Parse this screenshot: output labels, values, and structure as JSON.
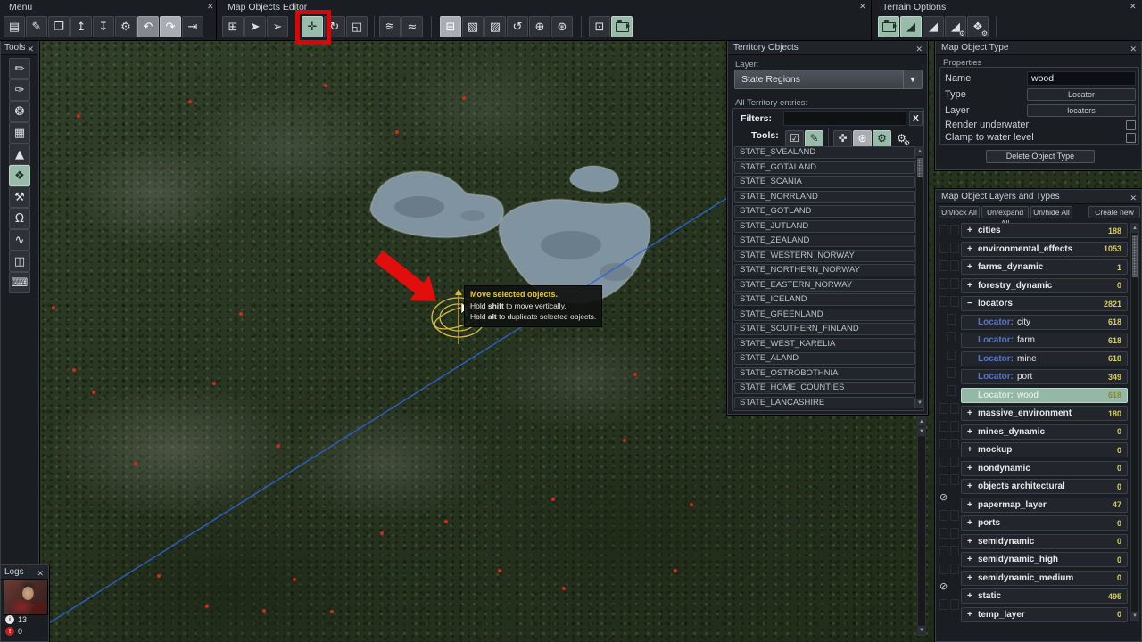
{
  "ui": {
    "close_glyph": "✕",
    "arrow_up": "▲",
    "arrow_down": "▼",
    "dropdown_arrow": "▼"
  },
  "colors": {
    "accent": "#98bca9",
    "count_yellow": "#d8ce62",
    "locator_blue": "#5377c7",
    "annotation_red": "#de0404",
    "gizmo_yellow": "#e3c23c"
  },
  "menu": {
    "title": "Menu",
    "tools": [
      {
        "icon": "save-icon",
        "glyph": "▤"
      },
      {
        "icon": "edit-icon",
        "glyph": "✎"
      },
      {
        "icon": "duplicate-icon",
        "glyph": "❐"
      },
      {
        "icon": "import-icon",
        "glyph": "↥"
      },
      {
        "icon": "export-icon",
        "glyph": "↧"
      },
      {
        "icon": "settings-gear-icon",
        "glyph": "⚙"
      },
      {
        "icon": "undo-icon",
        "glyph": "↶",
        "state": "pressed"
      },
      {
        "icon": "redo-icon",
        "glyph": "↷",
        "state": "pressed2"
      },
      {
        "icon": "exit-icon",
        "glyph": "⇥"
      }
    ]
  },
  "map_objects_editor": {
    "title": "Map Objects Editor",
    "groups": [
      [
        {
          "icon": "add-object-icon",
          "glyph": "⊞"
        },
        {
          "icon": "select-object-icon",
          "glyph": "➤"
        },
        {
          "icon": "box-select-object-icon",
          "glyph": "➢"
        }
      ],
      [
        {
          "icon": "move-object-icon",
          "glyph": "✛",
          "state": "selected",
          "boxed": true
        },
        {
          "icon": "rotate-object-icon",
          "glyph": "↻"
        },
        {
          "icon": "scale-object-icon",
          "glyph": "◱"
        }
      ],
      [
        {
          "icon": "vegetation-water-icon",
          "glyph": "≋"
        },
        {
          "icon": "object-water-icon",
          "glyph": "≈"
        }
      ],
      [
        {
          "icon": "delete-object-icon",
          "glyph": "⊟",
          "state": "pressed2"
        },
        {
          "icon": "paste-object-icon",
          "glyph": "▧"
        },
        {
          "icon": "edit-instance-icon",
          "glyph": "▨"
        },
        {
          "icon": "randomize-rotation-icon",
          "glyph": "↺"
        },
        {
          "icon": "add-variant-icon",
          "glyph": "⊕"
        },
        {
          "icon": "scatter-objects-icon",
          "glyph": "⊛"
        }
      ],
      [
        {
          "icon": "focus-selection-icon",
          "glyph": "⊡"
        },
        {
          "icon": "camera-mode-icon",
          "state": "selected"
        }
      ]
    ]
  },
  "terrain_options": {
    "title": "Terrain Options",
    "tools": [
      {
        "icon": "automated-camera-icon",
        "state": "selected"
      },
      {
        "icon": "terrain-view-icon",
        "glyph": "◢",
        "state": "selected"
      },
      {
        "icon": "terrain-graph-icon",
        "glyph": "◢"
      },
      {
        "icon": "terrain-settings-icon",
        "glyph": "◢",
        "sub": "⚙"
      },
      {
        "icon": "shapes-settings-icon",
        "glyph": "❖",
        "sub": "⚙"
      }
    ]
  },
  "tools_sidebar": {
    "title": "Tools",
    "items": [
      {
        "icon": "brush-icon",
        "glyph": "✏"
      },
      {
        "icon": "detail-brush-icon",
        "glyph": "✑"
      },
      {
        "icon": "palette-icon",
        "glyph": "❂"
      },
      {
        "icon": "grid-icon",
        "glyph": "▦"
      },
      {
        "icon": "terrain-height-icon",
        "glyph": "▲"
      },
      {
        "icon": "object-placement-icon",
        "glyph": "❖",
        "state": "selected"
      },
      {
        "icon": "object-brush-icon",
        "glyph": "⚒"
      },
      {
        "icon": "creature-icon",
        "glyph": "Ω"
      },
      {
        "icon": "spline-icon",
        "glyph": "∿"
      },
      {
        "icon": "mask-icon",
        "glyph": "◫"
      },
      {
        "icon": "controller-icon",
        "glyph": "⌨"
      }
    ]
  },
  "territory_objects": {
    "title": "Territory Objects",
    "layer_label": "Layer:",
    "layer_value": "State Regions",
    "entries_label": "All Territory entries:",
    "filters_label": "Filters:",
    "filters_value": "",
    "clear_button": "X",
    "tools_label": "Tools:",
    "tool_icons": [
      {
        "icon": "select-check-icon",
        "glyph": "☑"
      },
      {
        "icon": "paint-territory-icon",
        "glyph": "✎",
        "state": "selected"
      },
      {
        "divider": true
      },
      {
        "icon": "probe-territory-icon",
        "glyph": "✜"
      },
      {
        "icon": "fill-objects-icon",
        "glyph": "⊛",
        "state": "pressed2"
      },
      {
        "icon": "auto-gears-icon",
        "glyph": "⚙",
        "state": "selected"
      },
      {
        "icon": "settings-gears-icon",
        "glyph": "⚙",
        "sub": "⚙",
        "bare": true
      }
    ],
    "states": [
      "STATE_SVEALAND",
      "STATE_GOTALAND",
      "STATE_SCANIA",
      "STATE_NORRLAND",
      "STATE_GOTLAND",
      "STATE_JUTLAND",
      "STATE_ZEALAND",
      "STATE_WESTERN_NORWAY",
      "STATE_NORTHERN_NORWAY",
      "STATE_EASTERN_NORWAY",
      "STATE_ICELAND",
      "STATE_GREENLAND",
      "STATE_SOUTHERN_FINLAND",
      "STATE_WEST_KARELIA",
      "STATE_ALAND",
      "STATE_OSTROBOTHNIA",
      "STATE_HOME_COUNTIES",
      "STATE_LANCASHIRE"
    ]
  },
  "map_object_type": {
    "title": "Map Object Type",
    "section_label": "Properties",
    "name_label": "Name",
    "name_value": "wood",
    "type_label": "Type",
    "type_value": "Locator",
    "layer_label": "Layer",
    "layer_value": "locators",
    "render_underwater_label": "Render underwater",
    "clamp_label": "Clamp to water level",
    "delete_button": "Delete Object Type"
  },
  "layers_panel": {
    "title": "Map Object Layers and Types",
    "buttons": [
      "Un/lock All",
      "Un/expand All",
      "Un/hide All",
      "Create new"
    ],
    "rows": [
      {
        "level": 0,
        "expand": "+",
        "name": "cities",
        "count": "188"
      },
      {
        "level": 0,
        "expand": "+",
        "name": "environmental_effects",
        "count": "1053"
      },
      {
        "level": 0,
        "expand": "+",
        "name": "farms_dynamic",
        "count": "1"
      },
      {
        "level": 0,
        "expand": "+",
        "name": "forestry_dynamic",
        "count": "0"
      },
      {
        "level": 0,
        "expand": "−",
        "name": "locators",
        "count": "2821"
      },
      {
        "level": 1,
        "prefix": "Locator:",
        "name": "city",
        "count": "618"
      },
      {
        "level": 1,
        "prefix": "Locator:",
        "name": "farm",
        "count": "618"
      },
      {
        "level": 1,
        "prefix": "Locator:",
        "name": "mine",
        "count": "618"
      },
      {
        "level": 1,
        "prefix": "Locator:",
        "name": "port",
        "count": "349"
      },
      {
        "level": 1,
        "prefix": "Locator:",
        "name": "wood",
        "count": "618",
        "selected": true
      },
      {
        "level": 0,
        "expand": "+",
        "name": "massive_environment",
        "count": "180"
      },
      {
        "level": 0,
        "expand": "+",
        "name": "mines_dynamic",
        "count": "0"
      },
      {
        "level": 0,
        "expand": "+",
        "name": "mockup",
        "count": "0"
      },
      {
        "level": 0,
        "expand": "+",
        "name": "nondynamic",
        "count": "0"
      },
      {
        "level": 0,
        "expand": "+",
        "name": "objects architectural",
        "count": "0"
      },
      {
        "level": 0,
        "expand": "+",
        "name": "papermap_layer",
        "count": "47",
        "hidden": true
      },
      {
        "level": 0,
        "expand": "+",
        "name": "ports",
        "count": "0"
      },
      {
        "level": 0,
        "expand": "+",
        "name": "semidynamic",
        "count": "0"
      },
      {
        "level": 0,
        "expand": "+",
        "name": "semidynamic_high",
        "count": "0"
      },
      {
        "level": 0,
        "expand": "+",
        "name": "semidynamic_medium",
        "count": "0"
      },
      {
        "level": 0,
        "expand": "+",
        "name": "static",
        "count": "495",
        "hidden": true
      },
      {
        "level": 0,
        "expand": "+",
        "name": "temp_layer",
        "count": "0"
      }
    ]
  },
  "logs": {
    "title": "Logs",
    "info_count": "13",
    "alert_count": "0"
  },
  "map_tooltip": {
    "title": "Move selected objects.",
    "lines": [
      [
        {
          "t": "Hold "
        },
        {
          "t": "shift",
          "b": 1
        },
        {
          "t": " to move vertically."
        }
      ],
      [
        {
          "t": "Hold "
        },
        {
          "t": "alt",
          "b": 1
        },
        {
          "t": " to duplicate selected objects."
        }
      ]
    ]
  }
}
